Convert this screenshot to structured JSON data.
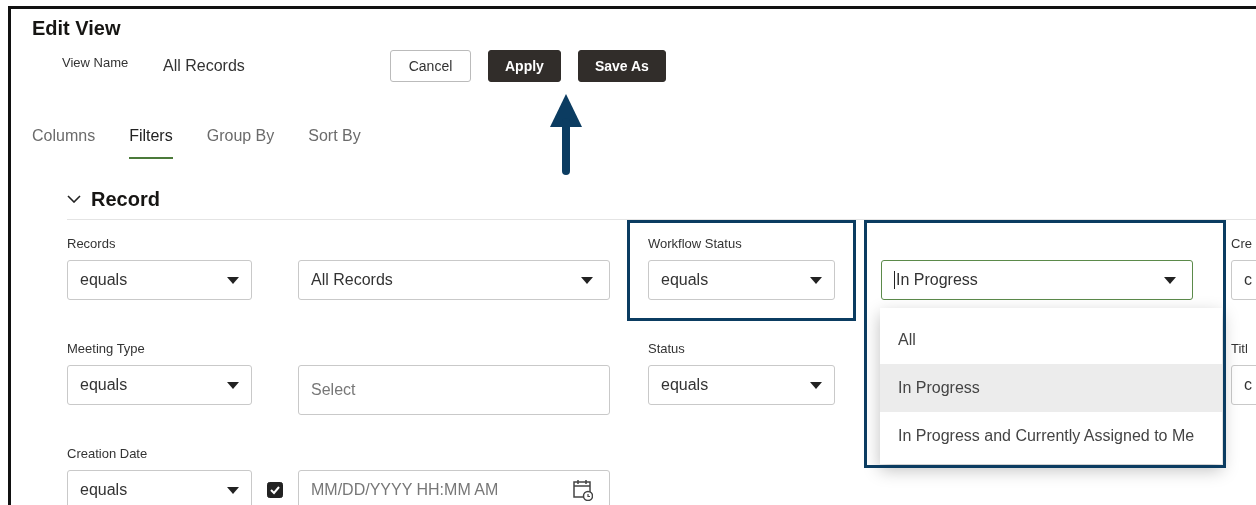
{
  "title": "Edit View",
  "view_name": {
    "label": "View Name",
    "value": "All Records"
  },
  "buttons": [
    {
      "label": "Cancel",
      "kind": "secondary"
    },
    {
      "label": "Apply",
      "kind": "primary"
    },
    {
      "label": "Save As",
      "kind": "primary"
    }
  ],
  "tabs": [
    {
      "label": "Columns",
      "selected": false
    },
    {
      "label": "Filters",
      "selected": true
    },
    {
      "label": "Group By",
      "selected": false
    },
    {
      "label": "Sort By",
      "selected": false
    }
  ],
  "section": {
    "title": "Record",
    "expanded": true
  },
  "filters": [
    {
      "kind": "select",
      "label": "Records",
      "operator": "equals",
      "value": "All Records"
    },
    {
      "kind": "combo",
      "label": "Workflow Status",
      "operator": "equals",
      "value": "In Progress"
    },
    {
      "kind": "cut",
      "label": "Cre",
      "operator": "c"
    },
    {
      "kind": "text",
      "label": "Meeting Type",
      "operator": "equals",
      "placeholder": "Select"
    },
    {
      "kind": "covered",
      "label": "Status",
      "operator": "equals"
    },
    {
      "kind": "cut",
      "label": "Titl",
      "operator": "c"
    },
    {
      "kind": "date",
      "label": "Creation Date",
      "operator": "equals",
      "checked": true,
      "placeholder": "MM/DD/YYYY HH:MM AM"
    }
  ],
  "dropdown": {
    "options": [
      {
        "label": "All",
        "selected": false
      },
      {
        "label": "In Progress",
        "selected": true
      },
      {
        "label": "In Progress and Currently Assigned to Me",
        "selected": false
      }
    ]
  }
}
